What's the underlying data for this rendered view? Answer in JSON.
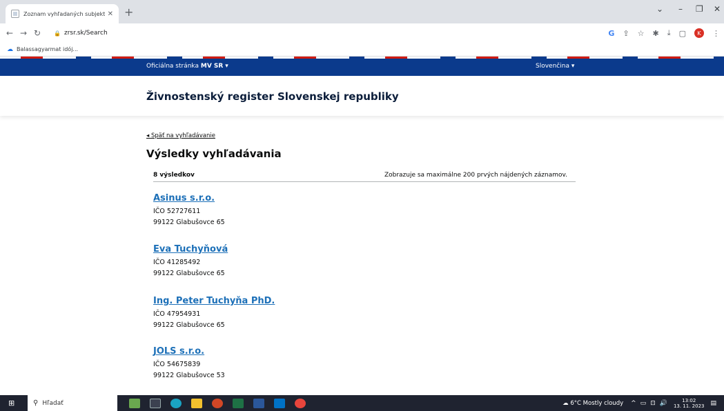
{
  "browser": {
    "tab_title": "Zoznam vyhľadaných subjektov",
    "url": "zrsr.sk/Search",
    "bookmark": "Balassagyarmat idój...",
    "profile_initial": "K"
  },
  "gov_bar": {
    "official_prefix": "Oficiálna stránka ",
    "official_bold": "MV SR",
    "language": "Slovenčina"
  },
  "site": {
    "title": "Živnostenský register Slovenskej republiky"
  },
  "main": {
    "back_link": "Späť na vyhľadávanie",
    "heading": "Výsledky vyhľadávania",
    "result_count": "8 výsledkov",
    "result_note": "Zobrazuje sa maximálne 200 prvých nájdených záznamov.",
    "results": [
      {
        "name": "Asinus s.r.o.",
        "ico": "IČO 52727611",
        "address": "99122 Glabušovce 65"
      },
      {
        "name": "Eva Tuchyňová",
        "ico": "IČO 41285492",
        "address": "99122 Glabušovce 65"
      },
      {
        "name": "Ing. Peter Tuchyňa PhD.",
        "ico": "IČO 47954931",
        "address": "99122 Glabušovce 65"
      },
      {
        "name": "JOLS s.r.o.",
        "ico": "IČO 54675839",
        "address": "99122 Glabušovce 53"
      }
    ]
  },
  "taskbar": {
    "search_placeholder": "Hľadať",
    "weather": "6°C  Mostly cloudy",
    "time": "13:02",
    "date": "13. 11. 2023"
  },
  "colors": {
    "gov_blue": "#0b3a8c",
    "link_blue": "#1d70b8",
    "stripe_red": "#d0190f"
  }
}
